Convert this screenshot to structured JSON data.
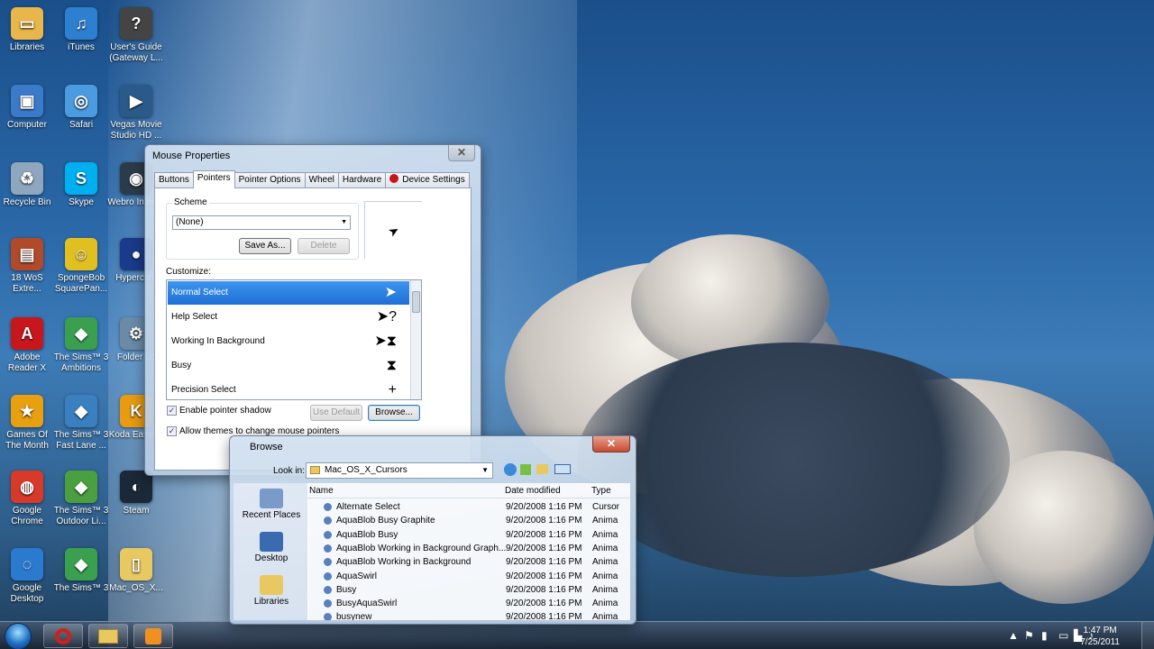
{
  "desktop_icons": [
    {
      "label": "Libraries",
      "glyph": "▭",
      "color": "#e8b64a"
    },
    {
      "label": "iTunes",
      "glyph": "♫",
      "color": "#2d7fd0"
    },
    {
      "label": "User's Guide (Gateway L...",
      "glyph": "?",
      "color": "#444444"
    },
    {
      "label": "Computer",
      "glyph": "▣",
      "color": "#3a7ac9"
    },
    {
      "label": "Safari",
      "glyph": "◎",
      "color": "#4a9be0"
    },
    {
      "label": "Vegas Movie Studio HD ...",
      "glyph": "▶",
      "color": "#2a5a8a"
    },
    {
      "label": "Recycle Bin",
      "glyph": "♻",
      "color": "#8fa6bf"
    },
    {
      "label": "Skype",
      "glyph": "S",
      "color": "#00aff0"
    },
    {
      "label": "Webro Interne",
      "glyph": "◉",
      "color": "#2b3b4b"
    },
    {
      "label": "18 WoS Extre...",
      "glyph": "▤",
      "color": "#b04a2a"
    },
    {
      "label": "SpongeBob SquarePan...",
      "glyph": "☺",
      "color": "#e0c020"
    },
    {
      "label": "Hypercam",
      "glyph": "●",
      "color": "#1a3a8a"
    },
    {
      "label": "Adobe Reader X",
      "glyph": "A",
      "color": "#c8161d"
    },
    {
      "label": "The Sims™ 3 Ambitions",
      "glyph": "◆",
      "color": "#3aa050"
    },
    {
      "label": "Folder Lo",
      "glyph": "⚙",
      "color": "#6a8aa8"
    },
    {
      "label": "Games Of The Month",
      "glyph": "★",
      "color": "#e8a010"
    },
    {
      "label": "The Sims™ 3 Fast Lane ...",
      "glyph": "◆",
      "color": "#3a80c0"
    },
    {
      "label": "Koda EasySh",
      "glyph": "K",
      "color": "#e89a10"
    },
    {
      "label": "Google Chrome",
      "glyph": "◍",
      "color": "#d83a2a"
    },
    {
      "label": "The Sims™ 3 Outdoor Li...",
      "glyph": "◆",
      "color": "#4aa040"
    },
    {
      "label": "Steam",
      "glyph": "◐",
      "color": "#1b2838"
    },
    {
      "label": "Google Desktop",
      "glyph": "◌",
      "color": "#2a7ad0"
    },
    {
      "label": "The Sims™ 3",
      "glyph": "◆",
      "color": "#3aa050"
    },
    {
      "label": "Mac_OS_X...",
      "glyph": "▯",
      "color": "#e8c860"
    }
  ],
  "mouse_properties": {
    "title": "Mouse Properties",
    "close": "✕",
    "tabs": [
      "Buttons",
      "Pointers",
      "Pointer Options",
      "Wheel",
      "Hardware",
      "Device Settings"
    ],
    "scheme_label": "Scheme",
    "scheme_value": "(None)",
    "save_as": "Save As...",
    "delete": "Delete",
    "customize_label": "Customize:",
    "cursors": [
      {
        "name": "Normal Select",
        "glyph": "➤"
      },
      {
        "name": "Help Select",
        "glyph": "➤?"
      },
      {
        "name": "Working In Background",
        "glyph": "➤⧗"
      },
      {
        "name": "Busy",
        "glyph": "⧗"
      },
      {
        "name": "Precision Select",
        "glyph": "+"
      }
    ],
    "enable_shadow": "Enable pointer shadow",
    "allow_themes": "Allow themes to change mouse pointers",
    "use_default": "Use Default",
    "browse": "Browse..."
  },
  "browse": {
    "title": "Browse",
    "close": "✕",
    "look_in_label": "Look in:",
    "look_in_value": "Mac_OS_X_Cursors",
    "places": [
      "Recent Places",
      "Desktop",
      "Libraries"
    ],
    "columns": [
      "Name",
      "Date modified",
      "Type"
    ],
    "files": [
      {
        "name": "Alternate Select",
        "date": "9/20/2008 1:16 PM",
        "type": "Cursor"
      },
      {
        "name": "AquaBlob Busy Graphite",
        "date": "9/20/2008 1:16 PM",
        "type": "Anima"
      },
      {
        "name": "AquaBlob Busy",
        "date": "9/20/2008 1:16 PM",
        "type": "Anima"
      },
      {
        "name": "AquaBlob Working in Background Graph...",
        "date": "9/20/2008 1:16 PM",
        "type": "Anima"
      },
      {
        "name": "AquaBlob Working in Background",
        "date": "9/20/2008 1:16 PM",
        "type": "Anima"
      },
      {
        "name": "AquaSwirl",
        "date": "9/20/2008 1:16 PM",
        "type": "Anima"
      },
      {
        "name": "Busy",
        "date": "9/20/2008 1:16 PM",
        "type": "Anima"
      },
      {
        "name": "BusyAquaSwirl",
        "date": "9/20/2008 1:16 PM",
        "type": "Anima"
      },
      {
        "name": "busynew",
        "date": "9/20/2008 1:16 PM",
        "type": "Anima"
      }
    ]
  },
  "taskbar": {
    "clock_time": "1:47 PM",
    "clock_date": "7/25/2011"
  }
}
